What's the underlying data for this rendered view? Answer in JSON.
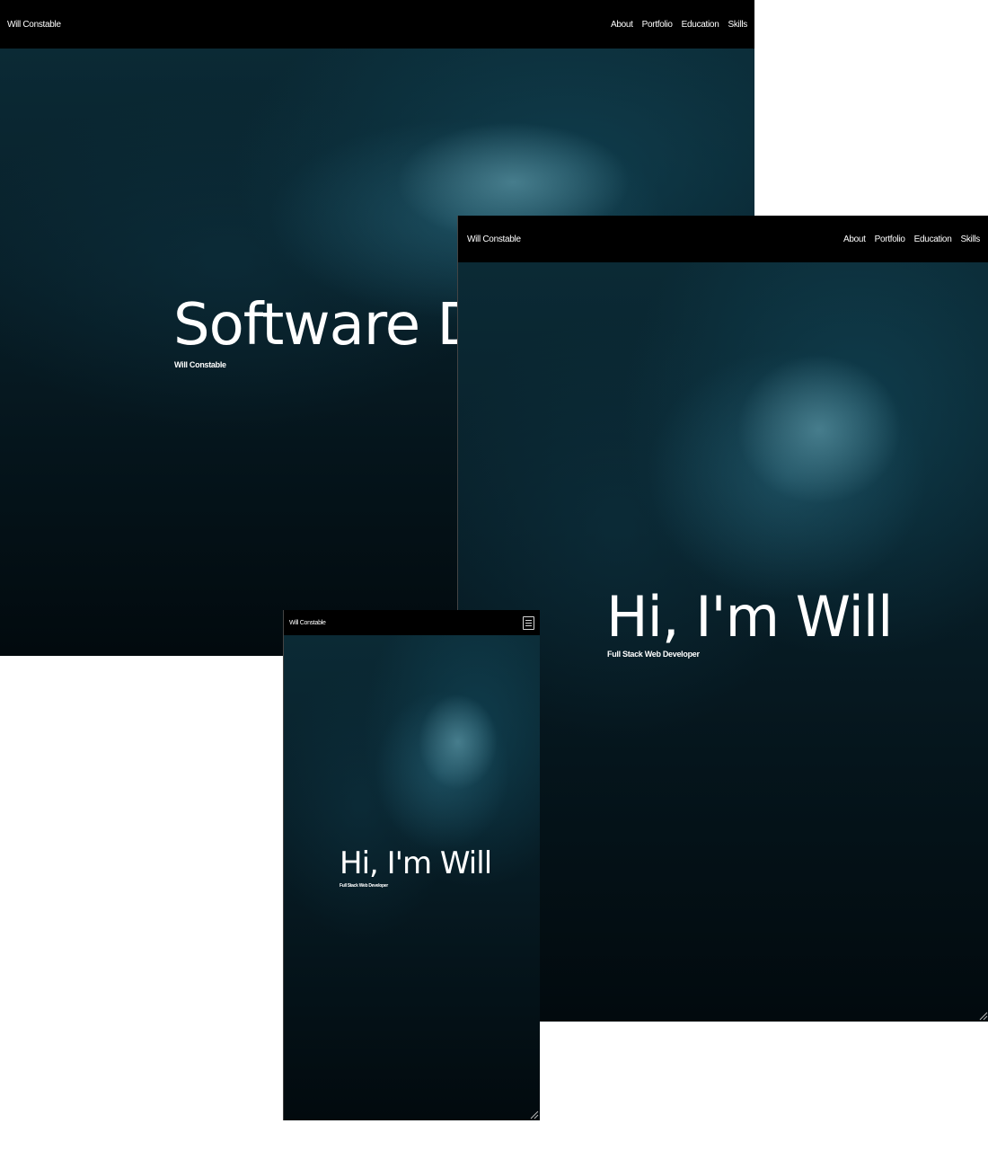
{
  "desktop": {
    "brand": "Will Constable",
    "nav": [
      "About",
      "Portfolio",
      "Education",
      "Skills"
    ],
    "headline": "Software Developer",
    "subheading": "Will Constable"
  },
  "tablet": {
    "brand": "Will Constable",
    "nav": [
      "About",
      "Portfolio",
      "Education",
      "Skills"
    ],
    "headline": "Hi, I'm Will",
    "subheading": "Full Stack Web Developer"
  },
  "mobile": {
    "brand": "Will Constable",
    "menu_icon": "hamburger-menu-icon",
    "headline": "Hi, I'm Will",
    "subheading": "Full Stack Web Developer"
  },
  "colors": {
    "navbar": "#000000",
    "hero_top": "#0b2a35",
    "hero_bottom": "#020a0e",
    "text": "#ffffff"
  }
}
